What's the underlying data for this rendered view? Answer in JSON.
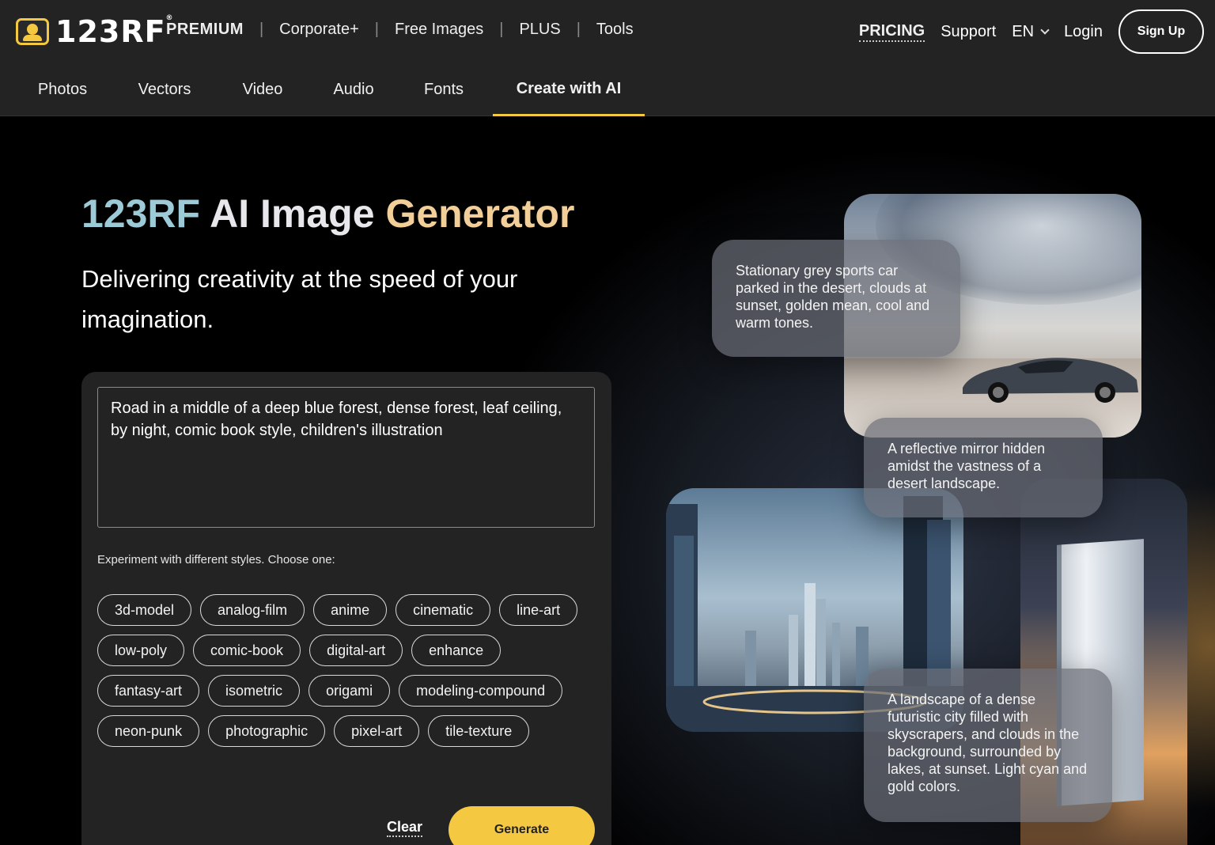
{
  "brand": {
    "name": "123RF",
    "reg": "®"
  },
  "topnav": {
    "premium": "PREMIUM",
    "separator": "|",
    "items": [
      "Corporate+",
      "Free Images",
      "PLUS",
      "Tools"
    ]
  },
  "rightnav": {
    "pricing": "PRICING",
    "support": "Support",
    "language": "EN",
    "login": "Login",
    "signup": "Sign Up"
  },
  "tabs": [
    "Photos",
    "Vectors",
    "Video",
    "Audio",
    "Fonts",
    "Create with AI"
  ],
  "active_tab": "Create with AI",
  "hero": {
    "title_part1": "123RF",
    "title_part2": "AI Image",
    "title_part3": "Generator",
    "subtitle": "Delivering creativity at the speed of your imagination."
  },
  "generator": {
    "prompt_value": "Road in a middle of a deep blue forest, dense forest, leaf ceiling, by night, comic book style, children's illustration",
    "styles_label": "Experiment with different styles. Choose one:",
    "styles": [
      "3d-model",
      "analog-film",
      "anime",
      "cinematic",
      "line-art",
      "low-poly",
      "comic-book",
      "digital-art",
      "enhance",
      "fantasy-art",
      "isometric",
      "origami",
      "modeling-compound",
      "neon-punk",
      "photographic",
      "pixel-art",
      "tile-texture"
    ],
    "clear_label": "Clear",
    "generate_label": "Generate"
  },
  "showcase": {
    "caption_car": "Stationary grey sports car parked in the desert, clouds at sunset, golden mean, cool and warm tones.",
    "caption_mirror": "A reflective mirror hidden amidst the vastness of a desert landscape.",
    "caption_city": "A landscape of a dense futuristic city filled with skyscrapers, and clouds in the background, surrounded by lakes, at sunset. Light cyan and gold colors."
  },
  "colors": {
    "accent": "#f5c842",
    "header_bg": "#232323",
    "panel_bg": "#232323"
  }
}
